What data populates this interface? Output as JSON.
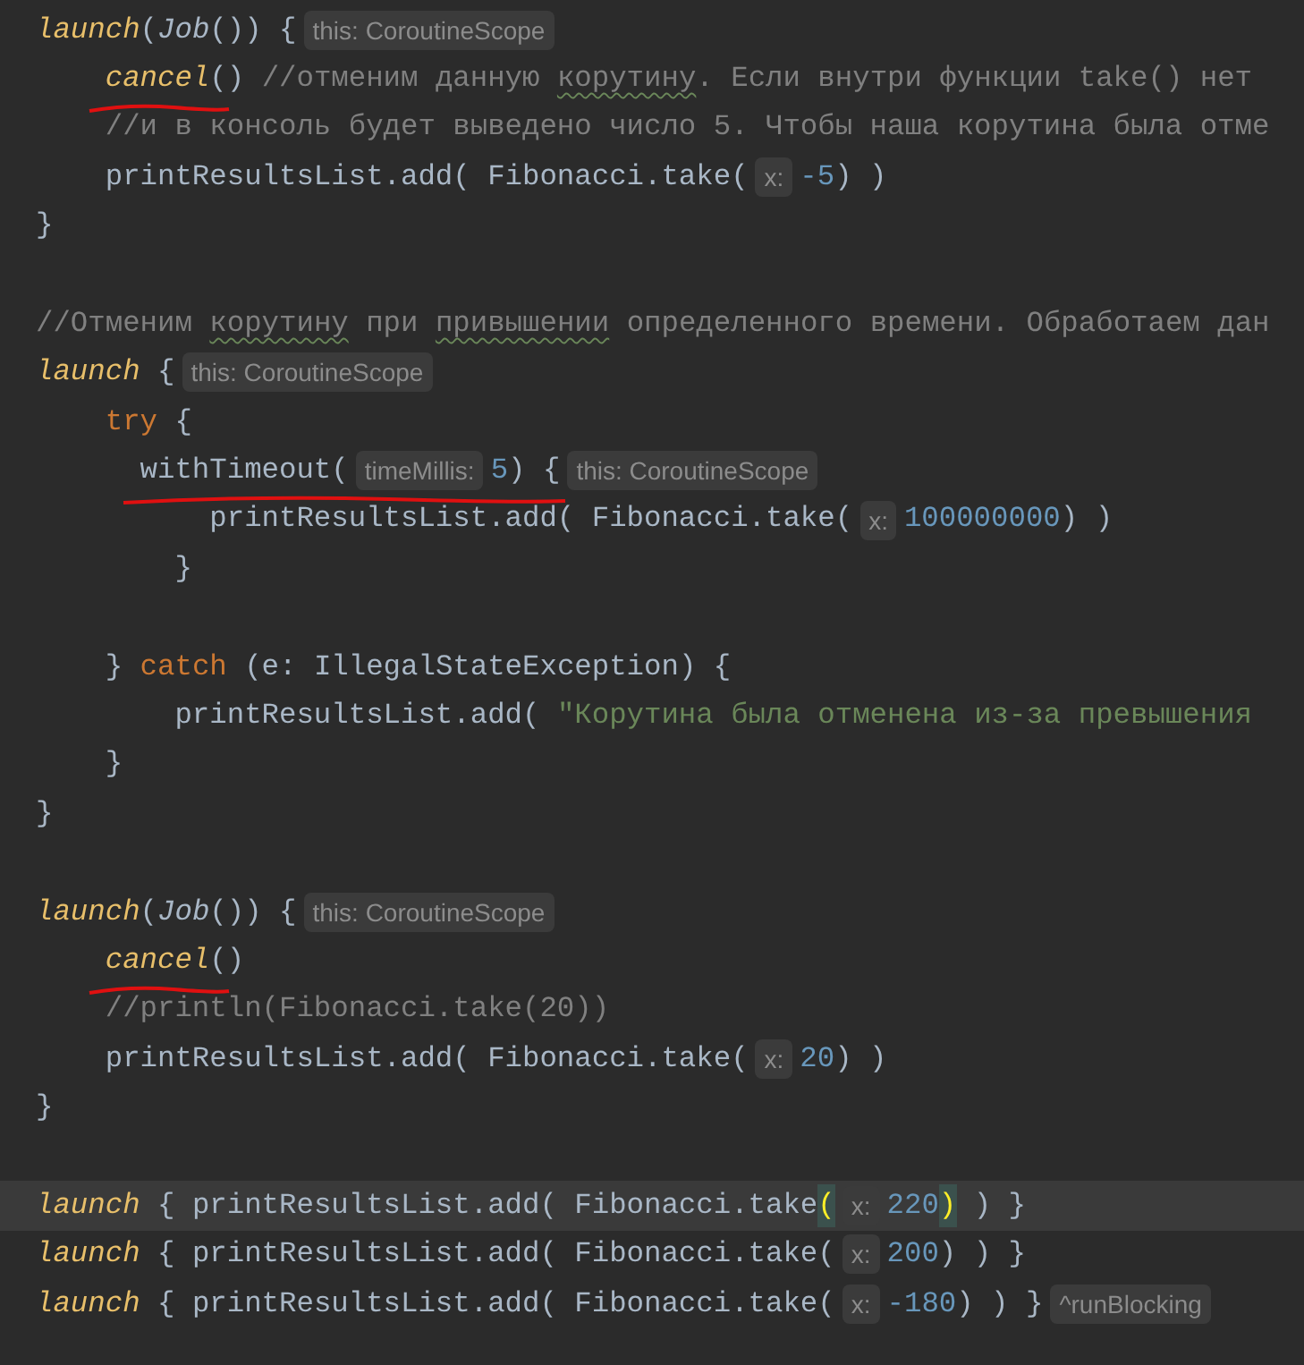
{
  "editor": {
    "lines": [
      {
        "kind": "code",
        "current": false,
        "tokens": [
          {
            "kind": "call",
            "text": "launch"
          },
          {
            "kind": "plain",
            "text": "("
          },
          {
            "kind": "italic",
            "text": "Job"
          },
          {
            "kind": "plain",
            "text": "()) {"
          },
          {
            "kind": "hint",
            "text": "this: CoroutineScope"
          }
        ]
      },
      {
        "kind": "code",
        "current": false,
        "tokens": [
          {
            "kind": "call",
            "text": "    cancel",
            "annotated": true
          },
          {
            "kind": "plain",
            "text": "() "
          },
          {
            "kind": "comment",
            "text": "//отменим данную "
          },
          {
            "kind": "comment",
            "text": "корутину",
            "typo": true
          },
          {
            "kind": "comment",
            "text": ". Если внутри функции take() нет"
          }
        ]
      },
      {
        "kind": "code",
        "current": false,
        "tokens": [
          {
            "kind": "comment",
            "text": "    //и в консоль будет выведено число 5. Чтобы наша корутина была отме"
          }
        ]
      },
      {
        "kind": "code",
        "current": false,
        "tokens": [
          {
            "kind": "plain",
            "text": "    printResultsList.add( Fibonacci.take("
          },
          {
            "kind": "hint",
            "text": "x:"
          },
          {
            "kind": "number",
            "text": "-5"
          },
          {
            "kind": "plain",
            "text": ") )"
          }
        ]
      },
      {
        "kind": "code",
        "current": false,
        "tokens": [
          {
            "kind": "plain",
            "text": "}"
          }
        ]
      },
      {
        "kind": "blank",
        "current": false
      },
      {
        "kind": "code",
        "current": false,
        "tokens": [
          {
            "kind": "comment",
            "text": "//Отменим "
          },
          {
            "kind": "comment",
            "text": "корутину",
            "typo": true
          },
          {
            "kind": "comment",
            "text": " при "
          },
          {
            "kind": "comment",
            "text": "привышении",
            "typo": true
          },
          {
            "kind": "comment",
            "text": " определенного времени. Обработаем дан"
          }
        ]
      },
      {
        "kind": "code",
        "current": false,
        "tokens": [
          {
            "kind": "call",
            "text": "launch"
          },
          {
            "kind": "plain",
            "text": " {"
          },
          {
            "kind": "hint",
            "text": "this: CoroutineScope"
          }
        ]
      },
      {
        "kind": "code",
        "current": false,
        "tokens": [
          {
            "kind": "keyword",
            "text": "    try"
          },
          {
            "kind": "plain",
            "text": " {"
          }
        ]
      },
      {
        "kind": "code",
        "current": false,
        "tokens": [
          {
            "kind": "plain",
            "text": "      withTimeout(",
            "annotated": true
          },
          {
            "kind": "hint",
            "text": "timeMillis:"
          },
          {
            "kind": "number",
            "text": "5"
          },
          {
            "kind": "plain",
            "text": ") {"
          },
          {
            "kind": "hint",
            "text": "this: CoroutineScope"
          }
        ]
      },
      {
        "kind": "code",
        "current": false,
        "tokens": [
          {
            "kind": "plain",
            "text": "          printResultsList.add( Fibonacci.take("
          },
          {
            "kind": "hint",
            "text": "x:"
          },
          {
            "kind": "number",
            "text": "100000000"
          },
          {
            "kind": "plain",
            "text": ") )"
          }
        ]
      },
      {
        "kind": "code",
        "current": false,
        "tokens": [
          {
            "kind": "plain",
            "text": "        }"
          }
        ]
      },
      {
        "kind": "blank",
        "current": false
      },
      {
        "kind": "code",
        "current": false,
        "tokens": [
          {
            "kind": "plain",
            "text": "    } "
          },
          {
            "kind": "keyword",
            "text": "catch"
          },
          {
            "kind": "plain",
            "text": " (e: IllegalStateException) {"
          }
        ]
      },
      {
        "kind": "code",
        "current": false,
        "tokens": [
          {
            "kind": "plain",
            "text": "        printResultsList.add( "
          },
          {
            "kind": "string",
            "text": "\"Корутина была отменена из-за превышения"
          }
        ]
      },
      {
        "kind": "code",
        "current": false,
        "tokens": [
          {
            "kind": "plain",
            "text": "    }"
          }
        ]
      },
      {
        "kind": "code",
        "current": false,
        "tokens": [
          {
            "kind": "plain",
            "text": "}"
          }
        ]
      },
      {
        "kind": "blank",
        "current": false
      },
      {
        "kind": "code",
        "current": false,
        "tokens": [
          {
            "kind": "call",
            "text": "launch"
          },
          {
            "kind": "plain",
            "text": "("
          },
          {
            "kind": "italic",
            "text": "Job"
          },
          {
            "kind": "plain",
            "text": "()) {"
          },
          {
            "kind": "hint",
            "text": "this: CoroutineScope"
          }
        ]
      },
      {
        "kind": "code",
        "current": false,
        "tokens": [
          {
            "kind": "call",
            "text": "    cancel",
            "annotated": true
          },
          {
            "kind": "plain",
            "text": "()"
          }
        ]
      },
      {
        "kind": "code",
        "current": false,
        "tokens": [
          {
            "kind": "comment",
            "text": "    //println(Fibonacci.take(20))"
          }
        ]
      },
      {
        "kind": "code",
        "current": false,
        "tokens": [
          {
            "kind": "plain",
            "text": "    printResultsList.add( Fibonacci.take("
          },
          {
            "kind": "hint",
            "text": "x:"
          },
          {
            "kind": "number",
            "text": "20"
          },
          {
            "kind": "plain",
            "text": ") )"
          }
        ]
      },
      {
        "kind": "code",
        "current": false,
        "tokens": [
          {
            "kind": "plain",
            "text": "}"
          }
        ]
      },
      {
        "kind": "blank",
        "current": false
      },
      {
        "kind": "code",
        "current": true,
        "tokens": [
          {
            "kind": "call",
            "text": "launch"
          },
          {
            "kind": "plain",
            "text": " { printResultsList.add( Fibonacci.take"
          },
          {
            "kind": "brace-match",
            "text": "("
          },
          {
            "kind": "hint",
            "text": "x:"
          },
          {
            "kind": "number",
            "text": "220"
          },
          {
            "kind": "brace-match",
            "text": ")"
          },
          {
            "kind": "plain",
            "text": " ) }"
          }
        ]
      },
      {
        "kind": "code",
        "current": false,
        "tokens": [
          {
            "kind": "call",
            "text": "launch"
          },
          {
            "kind": "plain",
            "text": " { printResultsList.add( Fibonacci.take("
          },
          {
            "kind": "hint",
            "text": "x:"
          },
          {
            "kind": "number",
            "text": "200"
          },
          {
            "kind": "plain",
            "text": ") ) }"
          }
        ]
      },
      {
        "kind": "code",
        "current": false,
        "tokens": [
          {
            "kind": "call",
            "text": "launch"
          },
          {
            "kind": "plain",
            "text": " { printResultsList.add( Fibonacci.take("
          },
          {
            "kind": "hint",
            "text": "x:"
          },
          {
            "kind": "number",
            "text": "-180"
          },
          {
            "kind": "plain",
            "text": ") ) }"
          },
          {
            "kind": "hint",
            "text": "^runBlocking"
          }
        ]
      }
    ]
  }
}
